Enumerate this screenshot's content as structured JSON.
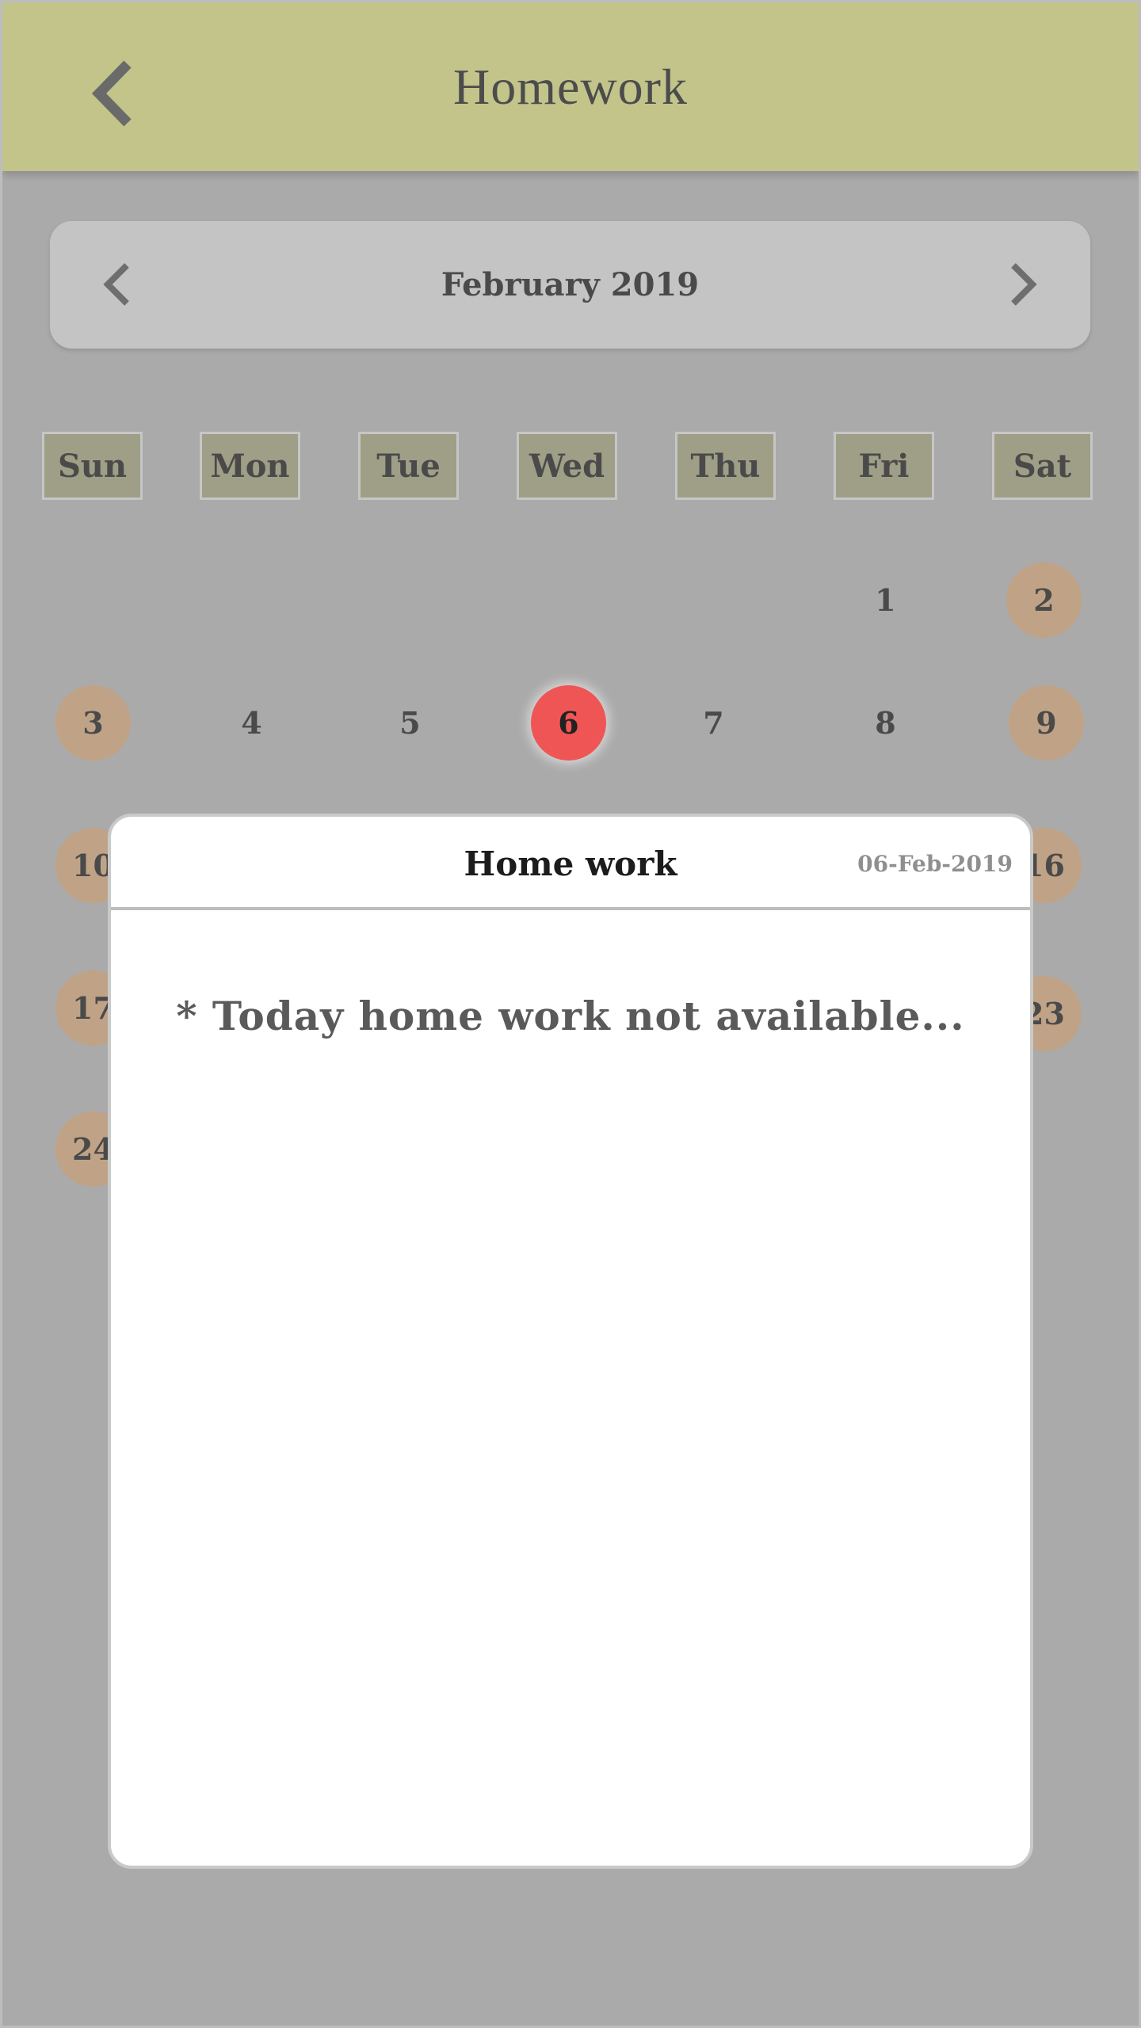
{
  "header": {
    "title": "Homework",
    "back_icon": "chevron-left-icon"
  },
  "calendar": {
    "month_label": "February 2019",
    "weekdays": [
      "Sun",
      "Mon",
      "Tue",
      "Wed",
      "Thu",
      "Fri",
      "Sat"
    ],
    "visible_days": [
      "1",
      "2",
      "3",
      "4",
      "5",
      "6",
      "7",
      "8",
      "9",
      "10",
      "16",
      "17",
      "23",
      "24"
    ],
    "selected_day": "6",
    "colors": {
      "weekend": "#c0a386",
      "selected": "#f05555",
      "weekday_header": "#9e9f86",
      "header_bg": "#c2c48a"
    }
  },
  "modal": {
    "title": "Home work",
    "date": "06-Feb-2019",
    "message": "* Today home work not available..."
  }
}
